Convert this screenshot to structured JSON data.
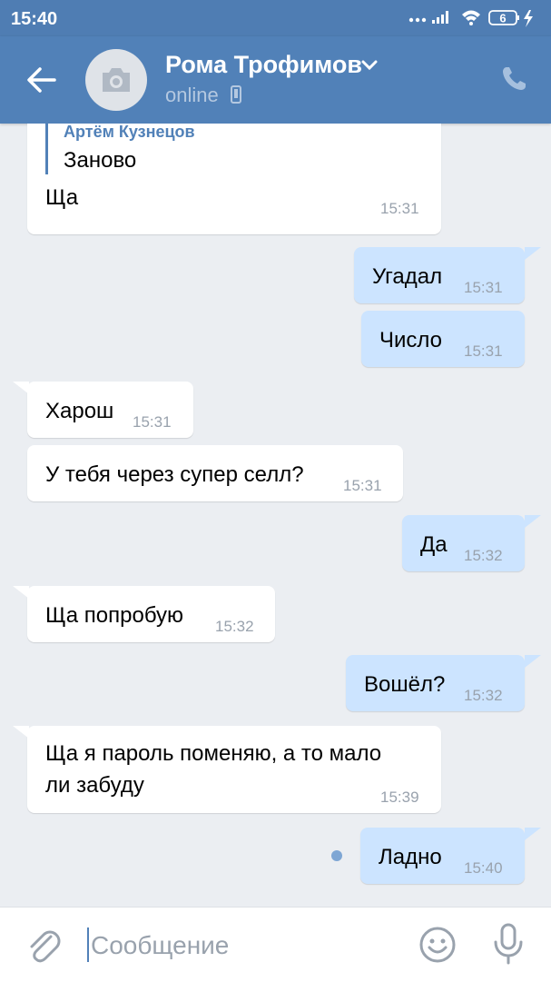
{
  "status_bar": {
    "time": "15:40",
    "battery": "6"
  },
  "header": {
    "name": "Рома Трофимов",
    "status": "online"
  },
  "messages": [
    {
      "dir": "in",
      "reply_author": "Артём Кузнецов",
      "reply_text": "Заново",
      "text": "Ща",
      "time": "15:31"
    },
    {
      "dir": "out",
      "text": "Угадал",
      "time": "15:31"
    },
    {
      "dir": "out",
      "text": "Число",
      "time": "15:31"
    },
    {
      "dir": "in",
      "text": "Харош",
      "time": "15:31"
    },
    {
      "dir": "in",
      "text": "У тебя через супер селл?",
      "time": "15:31"
    },
    {
      "dir": "out",
      "text": "Да",
      "time": "15:32"
    },
    {
      "dir": "in",
      "text": "Ща попробую",
      "time": "15:32"
    },
    {
      "dir": "out",
      "text": "Вошёл?",
      "time": "15:32"
    },
    {
      "dir": "in",
      "text_line1": "Ща я пароль поменяю, а то мало",
      "text_line2": "ли забуду",
      "time": "15:39"
    },
    {
      "dir": "out",
      "text": "Ладно",
      "time": "15:40"
    }
  ],
  "input": {
    "placeholder": "Сообщение"
  },
  "colors": {
    "header": "#5181b8",
    "outgoing": "#cce4ff",
    "incoming": "#ffffff",
    "background": "#ebeef2"
  }
}
